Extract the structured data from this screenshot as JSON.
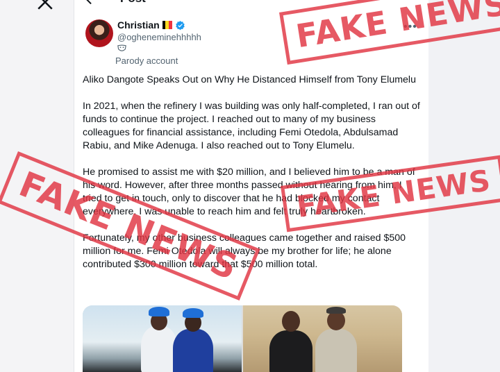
{
  "nav": {
    "logo_icon": "x-logo-icon"
  },
  "header": {
    "title": "Post",
    "back_icon": "back-arrow-icon"
  },
  "author": {
    "display_name": "Christian",
    "flag_colors": [
      "#000000",
      "#fdda24",
      "#ef3340"
    ],
    "handle": "@ogheneminehhhhh",
    "parody_label": "Parody account"
  },
  "post": {
    "paragraphs": [
      "Aliko Dangote Speaks Out on Why He Distanced Himself from Tony Elumelu",
      "In 2021, when the refinery I was building was only half-completed, I ran out of funds to continue the project. I reached out to many of my business colleagues for financial assistance, including Femi Otedola, Abdulsamad Rabiu, and Mike Adenuga. I also reached out to Tony Elumelu.",
      "He promised to assist me with $20 million, and I believed him to be a man of his word. However, after three months passed without hearing from him, I tried to get in touch, only to discover that he had blocked my contact everywhere. I was unable to reach him and felt truly heartbroken.",
      "Fortunately, my other business colleagues came together and raised $500 million for me. Femi Otedola will always be my brother for life; he alone contributed $300 million toward that $500 million total."
    ]
  },
  "stamps": [
    "FAKE NEWS",
    "FAKE NEWS",
    "FAKE NEWS"
  ],
  "colors": {
    "stamp_red": "#e03542",
    "verified_blue": "#1d9bf0"
  }
}
